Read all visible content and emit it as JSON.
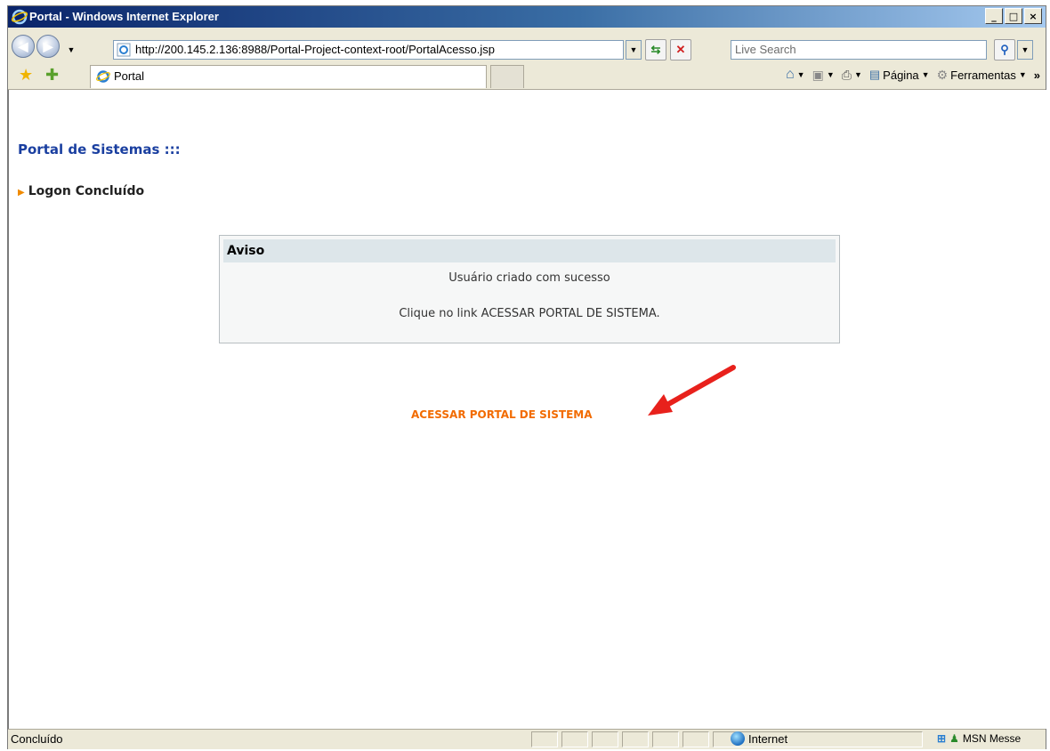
{
  "window": {
    "title": "Portal - Windows Internet Explorer",
    "minimize": "_",
    "maximize": "□",
    "close": "×"
  },
  "address": {
    "url": "http://200.145.2.136:8988/Portal-Project-context-root/PortalAcesso.jsp",
    "search_placeholder": "Live Search"
  },
  "tabs": [
    {
      "label": "Portal"
    }
  ],
  "commands": {
    "page": "Página",
    "tools": "Ferramentas"
  },
  "page": {
    "heading": "Portal de Sistemas :::",
    "section": "Logon Concluído",
    "notice": {
      "title": "Aviso",
      "line1": "Usuário criado com sucesso",
      "line2": "Clique no link ACESSAR PORTAL DE SISTEMA."
    },
    "link": "ACESSAR PORTAL DE SISTEMA"
  },
  "status": {
    "text": "Concluído",
    "zone": "Internet",
    "msn": "MSN Messe"
  },
  "colors": {
    "heading": "#1a3fa0",
    "link": "#f26b00",
    "arrow": "#e8211c"
  }
}
